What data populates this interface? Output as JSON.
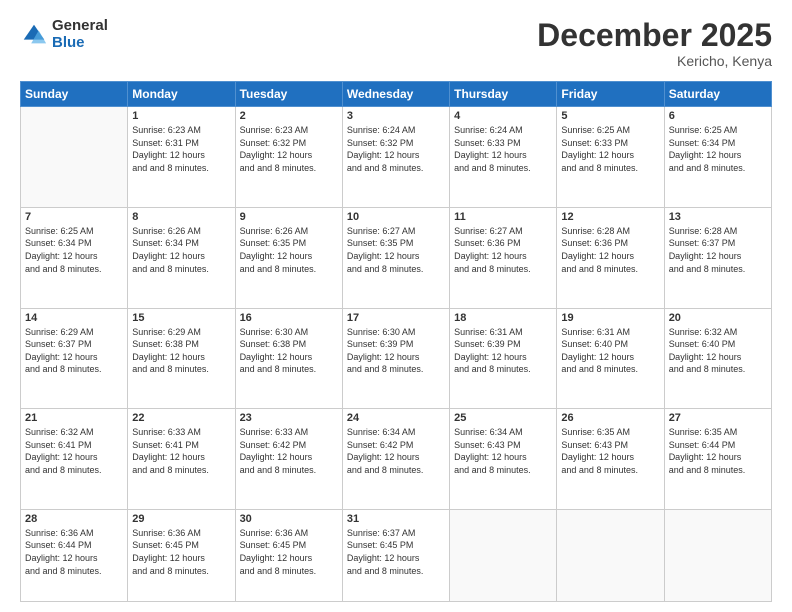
{
  "logo": {
    "general": "General",
    "blue": "Blue"
  },
  "header": {
    "month": "December 2025",
    "location": "Kericho, Kenya"
  },
  "weekdays": [
    "Sunday",
    "Monday",
    "Tuesday",
    "Wednesday",
    "Thursday",
    "Friday",
    "Saturday"
  ],
  "weeks": [
    [
      {
        "day": "",
        "sunrise": "",
        "sunset": "",
        "daylight": ""
      },
      {
        "day": "1",
        "sunrise": "Sunrise: 6:23 AM",
        "sunset": "Sunset: 6:31 PM",
        "daylight": "Daylight: 12 hours and 8 minutes."
      },
      {
        "day": "2",
        "sunrise": "Sunrise: 6:23 AM",
        "sunset": "Sunset: 6:32 PM",
        "daylight": "Daylight: 12 hours and 8 minutes."
      },
      {
        "day": "3",
        "sunrise": "Sunrise: 6:24 AM",
        "sunset": "Sunset: 6:32 PM",
        "daylight": "Daylight: 12 hours and 8 minutes."
      },
      {
        "day": "4",
        "sunrise": "Sunrise: 6:24 AM",
        "sunset": "Sunset: 6:33 PM",
        "daylight": "Daylight: 12 hours and 8 minutes."
      },
      {
        "day": "5",
        "sunrise": "Sunrise: 6:25 AM",
        "sunset": "Sunset: 6:33 PM",
        "daylight": "Daylight: 12 hours and 8 minutes."
      },
      {
        "day": "6",
        "sunrise": "Sunrise: 6:25 AM",
        "sunset": "Sunset: 6:34 PM",
        "daylight": "Daylight: 12 hours and 8 minutes."
      }
    ],
    [
      {
        "day": "7",
        "sunrise": "Sunrise: 6:25 AM",
        "sunset": "Sunset: 6:34 PM",
        "daylight": "Daylight: 12 hours and 8 minutes."
      },
      {
        "day": "8",
        "sunrise": "Sunrise: 6:26 AM",
        "sunset": "Sunset: 6:34 PM",
        "daylight": "Daylight: 12 hours and 8 minutes."
      },
      {
        "day": "9",
        "sunrise": "Sunrise: 6:26 AM",
        "sunset": "Sunset: 6:35 PM",
        "daylight": "Daylight: 12 hours and 8 minutes."
      },
      {
        "day": "10",
        "sunrise": "Sunrise: 6:27 AM",
        "sunset": "Sunset: 6:35 PM",
        "daylight": "Daylight: 12 hours and 8 minutes."
      },
      {
        "day": "11",
        "sunrise": "Sunrise: 6:27 AM",
        "sunset": "Sunset: 6:36 PM",
        "daylight": "Daylight: 12 hours and 8 minutes."
      },
      {
        "day": "12",
        "sunrise": "Sunrise: 6:28 AM",
        "sunset": "Sunset: 6:36 PM",
        "daylight": "Daylight: 12 hours and 8 minutes."
      },
      {
        "day": "13",
        "sunrise": "Sunrise: 6:28 AM",
        "sunset": "Sunset: 6:37 PM",
        "daylight": "Daylight: 12 hours and 8 minutes."
      }
    ],
    [
      {
        "day": "14",
        "sunrise": "Sunrise: 6:29 AM",
        "sunset": "Sunset: 6:37 PM",
        "daylight": "Daylight: 12 hours and 8 minutes."
      },
      {
        "day": "15",
        "sunrise": "Sunrise: 6:29 AM",
        "sunset": "Sunset: 6:38 PM",
        "daylight": "Daylight: 12 hours and 8 minutes."
      },
      {
        "day": "16",
        "sunrise": "Sunrise: 6:30 AM",
        "sunset": "Sunset: 6:38 PM",
        "daylight": "Daylight: 12 hours and 8 minutes."
      },
      {
        "day": "17",
        "sunrise": "Sunrise: 6:30 AM",
        "sunset": "Sunset: 6:39 PM",
        "daylight": "Daylight: 12 hours and 8 minutes."
      },
      {
        "day": "18",
        "sunrise": "Sunrise: 6:31 AM",
        "sunset": "Sunset: 6:39 PM",
        "daylight": "Daylight: 12 hours and 8 minutes."
      },
      {
        "day": "19",
        "sunrise": "Sunrise: 6:31 AM",
        "sunset": "Sunset: 6:40 PM",
        "daylight": "Daylight: 12 hours and 8 minutes."
      },
      {
        "day": "20",
        "sunrise": "Sunrise: 6:32 AM",
        "sunset": "Sunset: 6:40 PM",
        "daylight": "Daylight: 12 hours and 8 minutes."
      }
    ],
    [
      {
        "day": "21",
        "sunrise": "Sunrise: 6:32 AM",
        "sunset": "Sunset: 6:41 PM",
        "daylight": "Daylight: 12 hours and 8 minutes."
      },
      {
        "day": "22",
        "sunrise": "Sunrise: 6:33 AM",
        "sunset": "Sunset: 6:41 PM",
        "daylight": "Daylight: 12 hours and 8 minutes."
      },
      {
        "day": "23",
        "sunrise": "Sunrise: 6:33 AM",
        "sunset": "Sunset: 6:42 PM",
        "daylight": "Daylight: 12 hours and 8 minutes."
      },
      {
        "day": "24",
        "sunrise": "Sunrise: 6:34 AM",
        "sunset": "Sunset: 6:42 PM",
        "daylight": "Daylight: 12 hours and 8 minutes."
      },
      {
        "day": "25",
        "sunrise": "Sunrise: 6:34 AM",
        "sunset": "Sunset: 6:43 PM",
        "daylight": "Daylight: 12 hours and 8 minutes."
      },
      {
        "day": "26",
        "sunrise": "Sunrise: 6:35 AM",
        "sunset": "Sunset: 6:43 PM",
        "daylight": "Daylight: 12 hours and 8 minutes."
      },
      {
        "day": "27",
        "sunrise": "Sunrise: 6:35 AM",
        "sunset": "Sunset: 6:44 PM",
        "daylight": "Daylight: 12 hours and 8 minutes."
      }
    ],
    [
      {
        "day": "28",
        "sunrise": "Sunrise: 6:36 AM",
        "sunset": "Sunset: 6:44 PM",
        "daylight": "Daylight: 12 hours and 8 minutes."
      },
      {
        "day": "29",
        "sunrise": "Sunrise: 6:36 AM",
        "sunset": "Sunset: 6:45 PM",
        "daylight": "Daylight: 12 hours and 8 minutes."
      },
      {
        "day": "30",
        "sunrise": "Sunrise: 6:36 AM",
        "sunset": "Sunset: 6:45 PM",
        "daylight": "Daylight: 12 hours and 8 minutes."
      },
      {
        "day": "31",
        "sunrise": "Sunrise: 6:37 AM",
        "sunset": "Sunset: 6:45 PM",
        "daylight": "Daylight: 12 hours and 8 minutes."
      },
      {
        "day": "",
        "sunrise": "",
        "sunset": "",
        "daylight": ""
      },
      {
        "day": "",
        "sunrise": "",
        "sunset": "",
        "daylight": ""
      },
      {
        "day": "",
        "sunrise": "",
        "sunset": "",
        "daylight": ""
      }
    ]
  ]
}
